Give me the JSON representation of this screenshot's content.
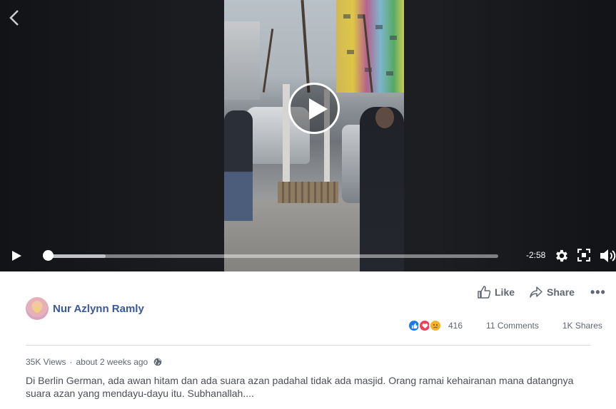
{
  "player": {
    "time_remaining": "-2:58",
    "progress_fraction": 0.0,
    "buffered_fraction": 0.13
  },
  "post": {
    "author": "Nur Azlynn Ramly",
    "like_label": "Like",
    "share_label": "Share",
    "more_label": "•••",
    "reaction_count": "416",
    "reactions": [
      "like-icon",
      "love-icon",
      "sad-icon"
    ],
    "comments": "11 Comments",
    "shares": "1K Shares",
    "views": "35K Views",
    "dot": "·",
    "time": "about 2 weeks ago",
    "privacy_icon": "globe-icon",
    "description": "Di Berlin German, ada awan hitam dan ada suara azan padahal tidak ada masjid. Orang ramai kehairanan mana datangnya suara azan yang mendayu-dayu itu. Subhanallah...."
  },
  "colors": {
    "author_blue": "#385898",
    "like_blue": "#1877f2",
    "love_red": "#f33e58",
    "sad_yellow": "#f7b125"
  }
}
